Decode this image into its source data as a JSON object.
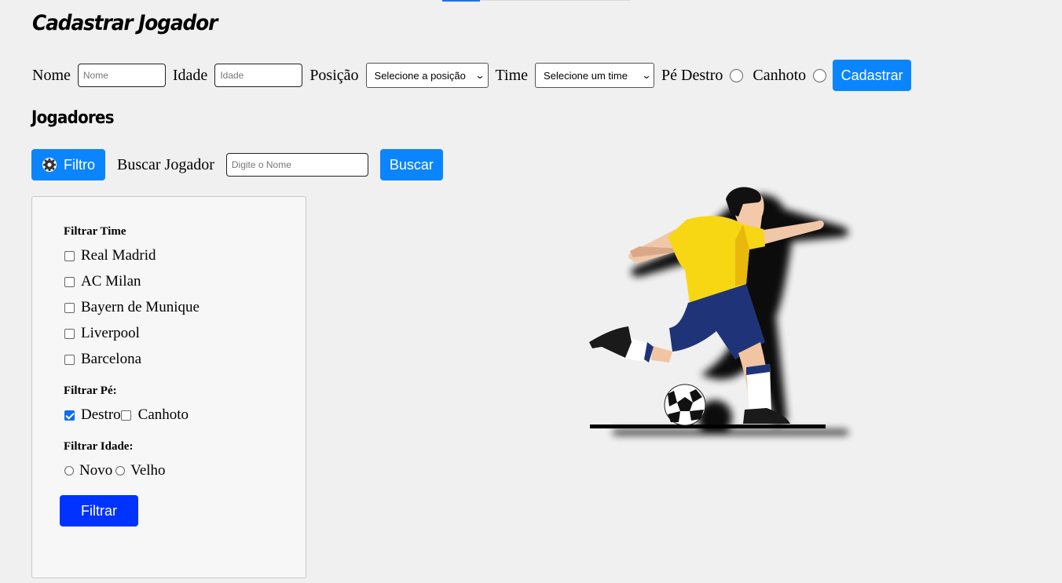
{
  "page": {
    "title": "Cadastrar Jogador",
    "players_heading": "Jogadores"
  },
  "register_form": {
    "name_label": "Nome",
    "name_placeholder": "Nome",
    "age_label": "Idade",
    "age_placeholder": "Idade",
    "position_label": "Posição",
    "position_selected": "Selecione a posição",
    "team_label": "Time",
    "team_selected": "Selecione um time",
    "foot_right_label": "Pé Destro",
    "foot_left_label": "Canhoto",
    "submit_label": "Cadastrar"
  },
  "search": {
    "filter_button_label": "Filtro",
    "search_label": "Buscar Jogador",
    "search_placeholder": "Digite o Nome",
    "search_button_label": "Buscar"
  },
  "filters": {
    "team_heading": "Filtrar Time",
    "teams": [
      {
        "label": "Real Madrid",
        "checked": false
      },
      {
        "label": "AC Milan",
        "checked": false
      },
      {
        "label": "Bayern de Munique",
        "checked": false
      },
      {
        "label": "Liverpool",
        "checked": false
      },
      {
        "label": "Barcelona",
        "checked": false
      }
    ],
    "foot_heading": "Filtrar Pé:",
    "foot_options": [
      {
        "label": "Destro",
        "checked": true
      },
      {
        "label": "Canhoto",
        "checked": false
      }
    ],
    "age_heading": "Filtrar Idade:",
    "age_options": [
      {
        "label": "Novo",
        "checked": false
      },
      {
        "label": "Velho",
        "checked": false
      }
    ],
    "apply_label": "Filtrar"
  },
  "colors": {
    "primary_button": "#0b84ff",
    "filter_apply_button": "#0033ff",
    "background": "#f0f0f0",
    "jersey_yellow": "#f7d713",
    "shorts_navy": "#1f3478"
  },
  "illustration": {
    "subject": "soccer-player-kicking-ball"
  }
}
